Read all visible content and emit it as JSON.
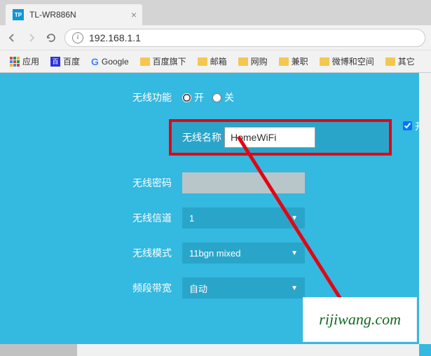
{
  "browser": {
    "tab_title": "TL-WR886N",
    "url": "192.168.1.1",
    "bookmarks": {
      "apps": "应用",
      "baidu": "百度",
      "google": "Google",
      "folders": [
        "百度旗下",
        "邮箱",
        "网购",
        "兼职",
        "微博和空间",
        "其它"
      ]
    }
  },
  "form": {
    "wireless_function": {
      "label": "无线功能",
      "on": "开",
      "off": "关",
      "value": "on"
    },
    "wireless_name": {
      "label": "无线名称",
      "value": "HomeWiFi"
    },
    "wireless_password": {
      "label": "无线密码",
      "value": ""
    },
    "channel": {
      "label": "无线信道",
      "value": "1"
    },
    "mode": {
      "label": "无线模式",
      "value": "11bgn mixed"
    },
    "bandwidth": {
      "label": "频段带宽",
      "value": "自动"
    },
    "side_checkbox": "开"
  },
  "watermark": "rijiwang.com"
}
